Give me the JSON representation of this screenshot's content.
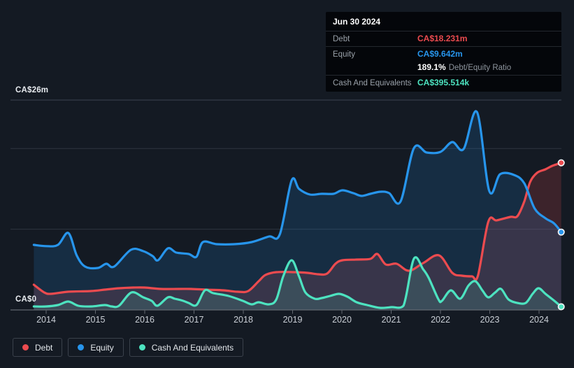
{
  "tooltip": {
    "date": "Jun 30 2024",
    "debt_label": "Debt",
    "debt_value": "CA$18.231m",
    "equity_label": "Equity",
    "equity_value": "CA$9.642m",
    "ratio_value": "189.1%",
    "ratio_label": "Debt/Equity Ratio",
    "cash_label": "Cash And Equivalents",
    "cash_value": "CA$395.514k"
  },
  "axis": {
    "y_top_label": "CA$26m",
    "y_zero_label": "CA$0"
  },
  "legend": {
    "items": [
      {
        "label": "Debt"
      },
      {
        "label": "Equity"
      },
      {
        "label": "Cash And Equivalents"
      }
    ]
  },
  "colors": {
    "background": "#141a23",
    "grid_mid": "#2e3540",
    "grid_top": "#3d4450",
    "axis_zero": "#626870",
    "tick_label": "#c9ced5",
    "marker_ring": "#f2f4f6"
  },
  "chart_data": {
    "type": "area",
    "x_ticks": [
      "2014",
      "2015",
      "2016",
      "2017",
      "2018",
      "2019",
      "2020",
      "2021",
      "2022",
      "2023",
      "2024"
    ],
    "xlabel": "",
    "ylabel": "CA$ millions",
    "ylim": [
      0,
      26
    ],
    "y_top_label_value": 26,
    "y_gridline_values": [
      10,
      20
    ],
    "x_range_years": [
      2013.75,
      2024.45
    ],
    "grid": "horizontal-only",
    "legend_position": "bottom-left",
    "last_point_date": "Jun 30 2024",
    "series": [
      {
        "name": "Debt",
        "color": "#ec4b4f",
        "fill": "rgba(235,77,80,0.19)",
        "points": [
          [
            2013.75,
            3.12
          ],
          [
            2013.96,
            2.17
          ],
          [
            2014.1,
            1.99
          ],
          [
            2014.44,
            2.25
          ],
          [
            2014.91,
            2.34
          ],
          [
            2015.19,
            2.51
          ],
          [
            2015.48,
            2.69
          ],
          [
            2015.76,
            2.77
          ],
          [
            2016.0,
            2.77
          ],
          [
            2016.33,
            2.6
          ],
          [
            2016.68,
            2.6
          ],
          [
            2016.94,
            2.6
          ],
          [
            2017.25,
            2.51
          ],
          [
            2017.6,
            2.43
          ],
          [
            2017.89,
            2.25
          ],
          [
            2018.1,
            2.34
          ],
          [
            2018.31,
            3.55
          ],
          [
            2018.45,
            4.33
          ],
          [
            2018.67,
            4.68
          ],
          [
            2019.02,
            4.68
          ],
          [
            2019.3,
            4.59
          ],
          [
            2019.52,
            4.42
          ],
          [
            2019.7,
            4.51
          ],
          [
            2019.87,
            5.72
          ],
          [
            2020.01,
            6.15
          ],
          [
            2020.3,
            6.24
          ],
          [
            2020.58,
            6.33
          ],
          [
            2020.72,
            6.93
          ],
          [
            2020.89,
            5.63
          ],
          [
            2021.11,
            5.72
          ],
          [
            2021.36,
            4.85
          ],
          [
            2021.65,
            5.81
          ],
          [
            2021.97,
            6.76
          ],
          [
            2022.24,
            4.59
          ],
          [
            2022.43,
            4.25
          ],
          [
            2022.64,
            4.16
          ],
          [
            2022.76,
            4.25
          ],
          [
            2022.97,
            10.92
          ],
          [
            2023.14,
            11.09
          ],
          [
            2023.42,
            11.53
          ],
          [
            2023.56,
            11.61
          ],
          [
            2023.7,
            13.43
          ],
          [
            2023.82,
            15.86
          ],
          [
            2023.96,
            16.99
          ],
          [
            2024.13,
            17.42
          ],
          [
            2024.27,
            17.85
          ],
          [
            2024.45,
            18.231
          ]
        ]
      },
      {
        "name": "Equity",
        "color": "#2795ec",
        "fill": "rgba(39,149,236,0.16)",
        "points": [
          [
            2013.75,
            8.06
          ],
          [
            2014.0,
            7.9
          ],
          [
            2014.24,
            8.06
          ],
          [
            2014.45,
            9.53
          ],
          [
            2014.62,
            6.76
          ],
          [
            2014.79,
            5.37
          ],
          [
            2015.05,
            5.2
          ],
          [
            2015.22,
            5.72
          ],
          [
            2015.38,
            5.37
          ],
          [
            2015.72,
            7.45
          ],
          [
            2015.97,
            7.28
          ],
          [
            2016.16,
            6.67
          ],
          [
            2016.27,
            6.15
          ],
          [
            2016.47,
            7.63
          ],
          [
            2016.64,
            7.11
          ],
          [
            2016.89,
            6.93
          ],
          [
            2017.05,
            6.59
          ],
          [
            2017.18,
            8.41
          ],
          [
            2017.46,
            8.15
          ],
          [
            2017.82,
            8.15
          ],
          [
            2018.17,
            8.41
          ],
          [
            2018.52,
            9.1
          ],
          [
            2018.74,
            9.36
          ],
          [
            2018.98,
            16.03
          ],
          [
            2019.13,
            14.99
          ],
          [
            2019.35,
            14.3
          ],
          [
            2019.59,
            14.39
          ],
          [
            2019.83,
            14.39
          ],
          [
            2020.01,
            14.82
          ],
          [
            2020.23,
            14.47
          ],
          [
            2020.4,
            14.13
          ],
          [
            2020.58,
            14.39
          ],
          [
            2020.79,
            14.65
          ],
          [
            2020.96,
            14.47
          ],
          [
            2021.19,
            13.43
          ],
          [
            2021.46,
            20.02
          ],
          [
            2021.72,
            19.5
          ],
          [
            2022.0,
            19.58
          ],
          [
            2022.24,
            20.8
          ],
          [
            2022.47,
            19.93
          ],
          [
            2022.74,
            24.52
          ],
          [
            2022.99,
            14.73
          ],
          [
            2023.21,
            16.81
          ],
          [
            2023.49,
            16.73
          ],
          [
            2023.7,
            15.69
          ],
          [
            2023.91,
            12.57
          ],
          [
            2024.13,
            11.35
          ],
          [
            2024.3,
            10.75
          ],
          [
            2024.45,
            9.642
          ]
        ]
      },
      {
        "name": "Cash And Equivalents",
        "color": "#4de3c0",
        "fill": "rgba(77,227,192,0.14)",
        "points": [
          [
            2013.75,
            0.43
          ],
          [
            2014.0,
            0.43
          ],
          [
            2014.24,
            0.61
          ],
          [
            2014.45,
            1.04
          ],
          [
            2014.65,
            0.52
          ],
          [
            2014.91,
            0.43
          ],
          [
            2015.19,
            0.61
          ],
          [
            2015.33,
            0.43
          ],
          [
            2015.48,
            0.52
          ],
          [
            2015.73,
            2.17
          ],
          [
            2015.97,
            1.56
          ],
          [
            2016.14,
            1.13
          ],
          [
            2016.26,
            0.52
          ],
          [
            2016.47,
            1.56
          ],
          [
            2016.61,
            1.39
          ],
          [
            2016.78,
            1.13
          ],
          [
            2016.89,
            0.87
          ],
          [
            2017.05,
            0.61
          ],
          [
            2017.22,
            2.43
          ],
          [
            2017.39,
            2.08
          ],
          [
            2017.7,
            1.73
          ],
          [
            2017.99,
            1.13
          ],
          [
            2018.17,
            0.69
          ],
          [
            2018.31,
            0.95
          ],
          [
            2018.52,
            0.69
          ],
          [
            2018.67,
            1.3
          ],
          [
            2018.81,
            4.16
          ],
          [
            2018.98,
            6.15
          ],
          [
            2019.13,
            4.16
          ],
          [
            2019.26,
            2.17
          ],
          [
            2019.45,
            1.39
          ],
          [
            2019.59,
            1.47
          ],
          [
            2019.76,
            1.73
          ],
          [
            2019.94,
            1.99
          ],
          [
            2020.11,
            1.65
          ],
          [
            2020.3,
            0.95
          ],
          [
            2020.51,
            0.61
          ],
          [
            2020.77,
            0.26
          ],
          [
            2021.01,
            0.35
          ],
          [
            2021.25,
            0.52
          ],
          [
            2021.46,
            6.33
          ],
          [
            2021.65,
            5.03
          ],
          [
            2021.76,
            3.99
          ],
          [
            2021.96,
            1.3
          ],
          [
            2022.03,
            1.13
          ],
          [
            2022.21,
            2.43
          ],
          [
            2022.4,
            1.39
          ],
          [
            2022.57,
            3.03
          ],
          [
            2022.71,
            3.55
          ],
          [
            2022.85,
            2.43
          ],
          [
            2022.97,
            1.56
          ],
          [
            2023.11,
            2.17
          ],
          [
            2023.23,
            2.6
          ],
          [
            2023.38,
            1.3
          ],
          [
            2023.56,
            0.87
          ],
          [
            2023.73,
            0.87
          ],
          [
            2023.87,
            1.99
          ],
          [
            2023.99,
            2.69
          ],
          [
            2024.13,
            1.99
          ],
          [
            2024.31,
            1.13
          ],
          [
            2024.45,
            0.396
          ]
        ]
      }
    ]
  }
}
